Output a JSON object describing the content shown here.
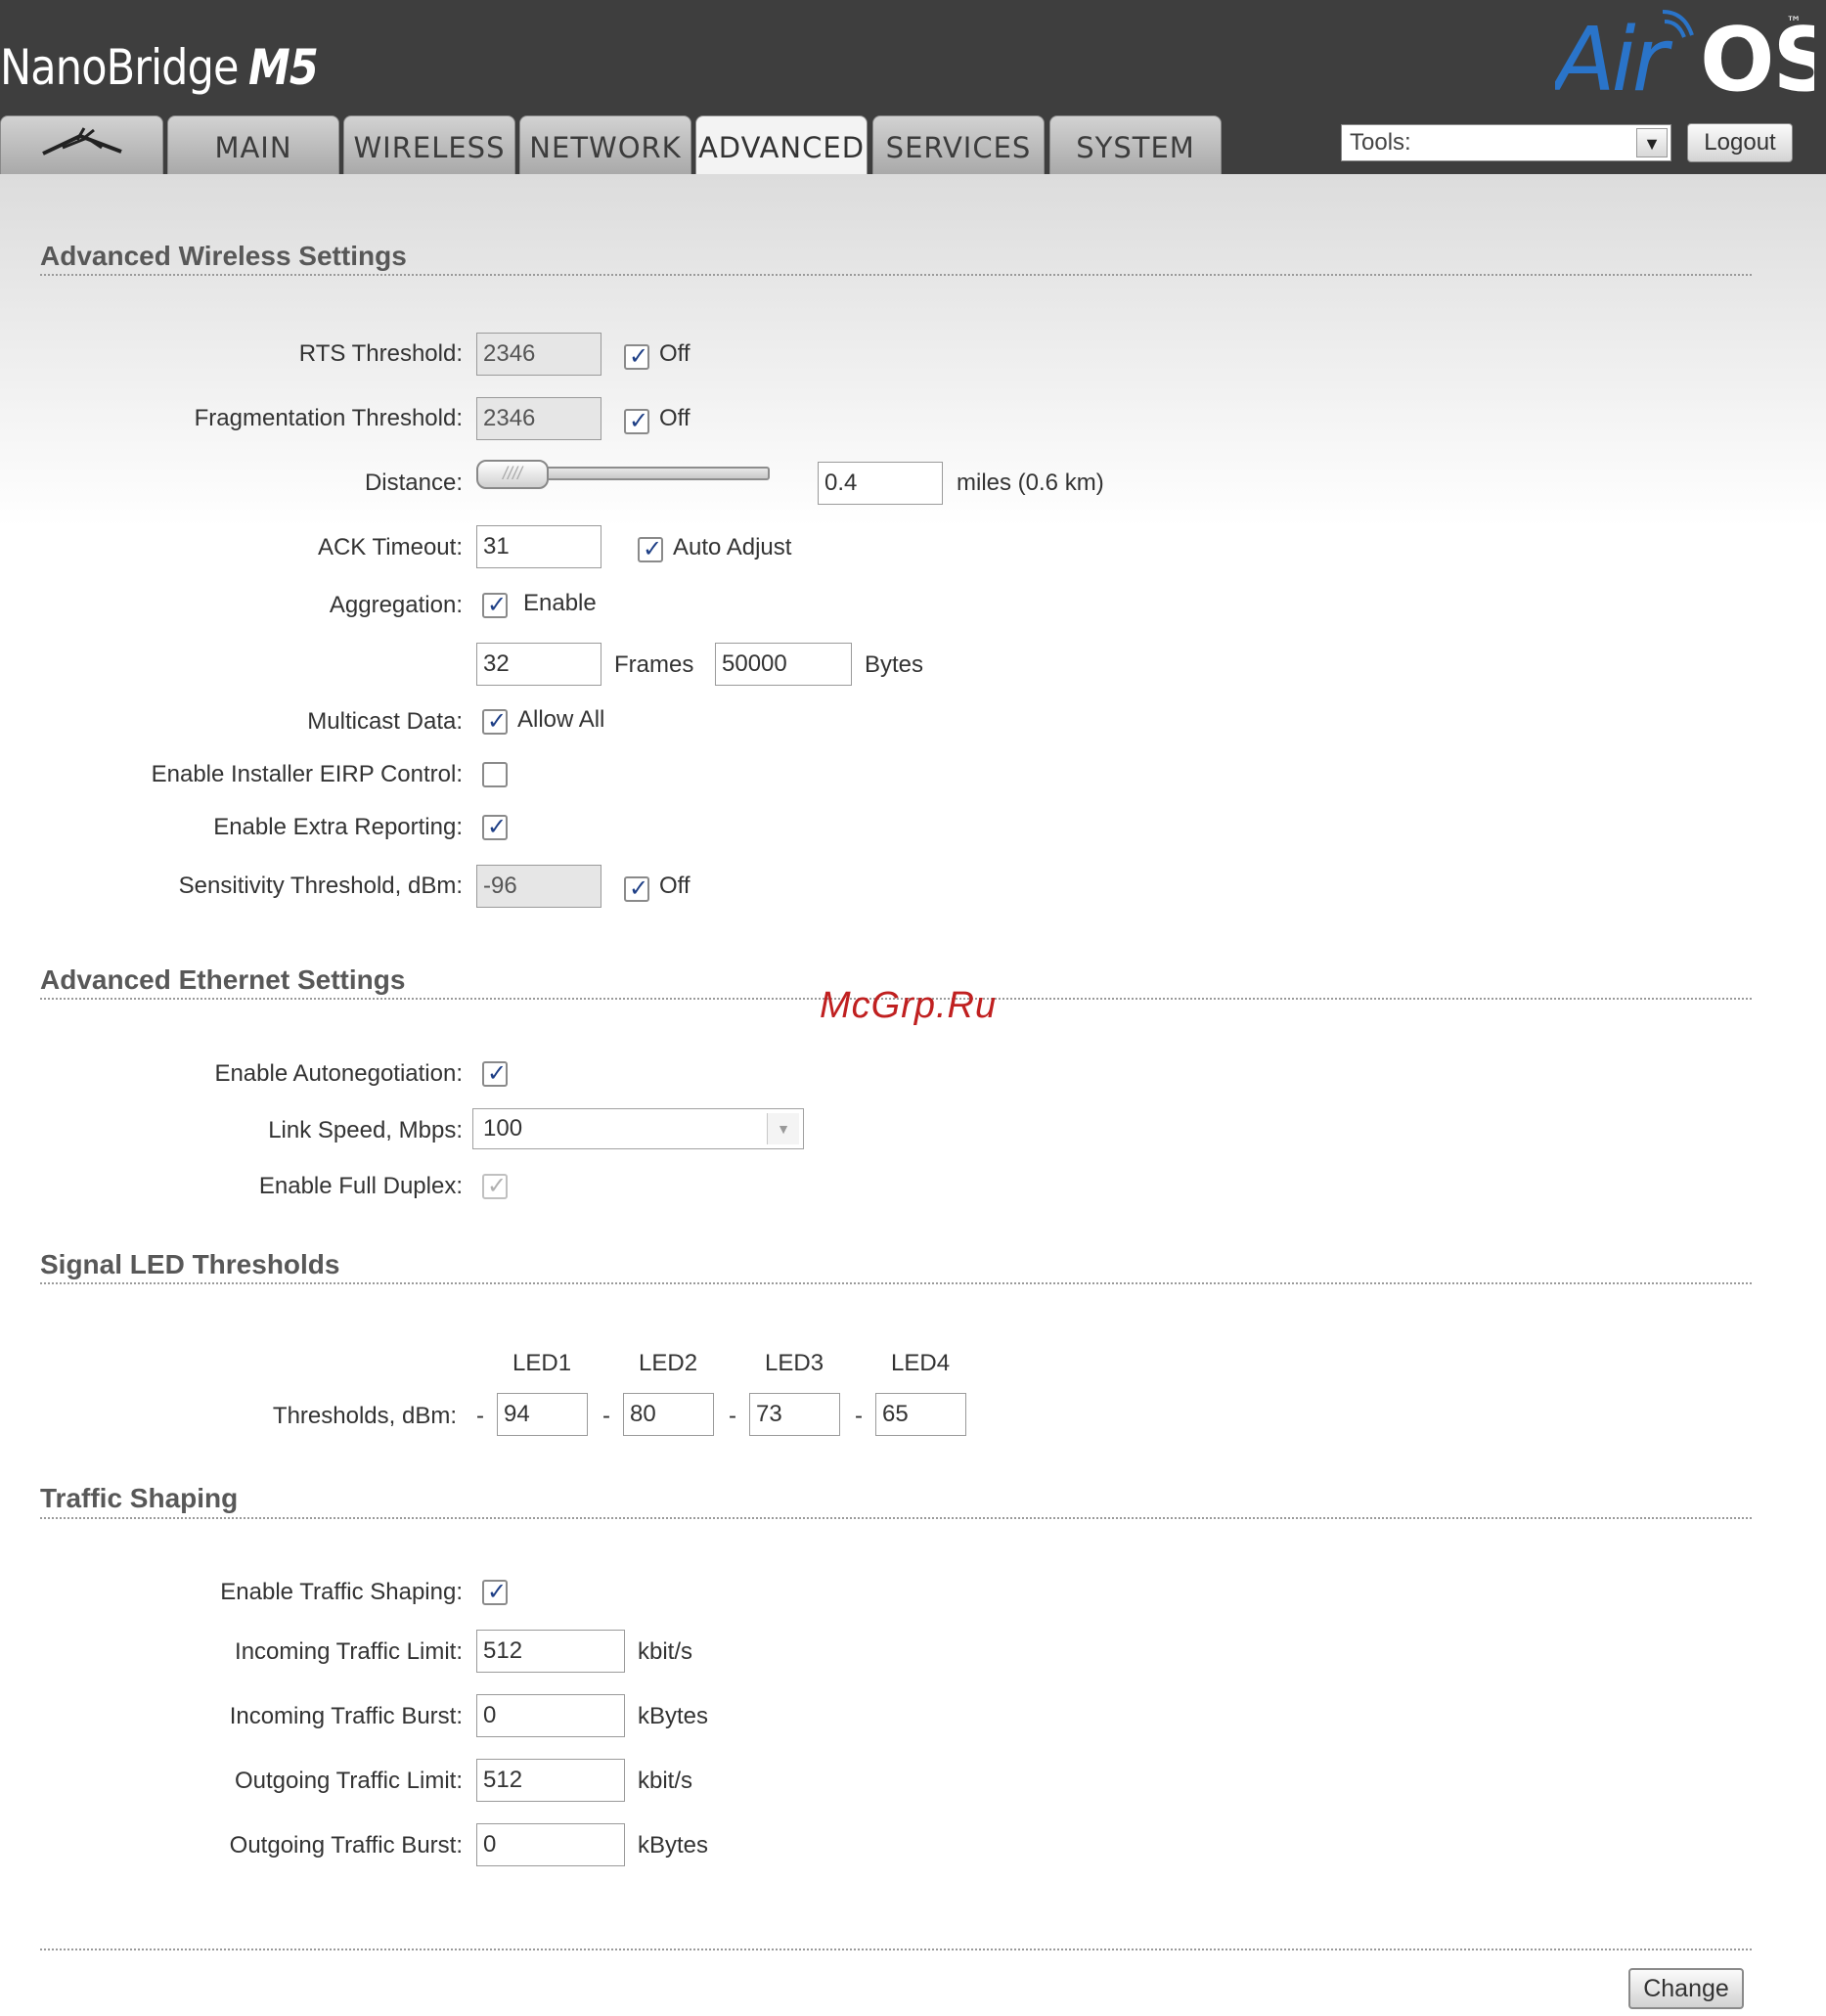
{
  "header": {
    "product_name": "NanoBridge",
    "product_model": "M5",
    "brand_logo": "AirOS",
    "brand_tm": "™",
    "tabs": [
      {
        "label": "MAIN"
      },
      {
        "label": "WIRELESS"
      },
      {
        "label": "NETWORK"
      },
      {
        "label": "ADVANCED"
      },
      {
        "label": "SERVICES"
      },
      {
        "label": "SYSTEM"
      }
    ],
    "active_tab": "ADVANCED",
    "logo_tab_icon": "ubiquiti-logo-icon",
    "tools_label": "Tools:",
    "logout_label": "Logout"
  },
  "wireless": {
    "title": "Advanced Wireless Settings",
    "rts_label": "RTS Threshold:",
    "rts_value": "2346",
    "rts_off_label": "Off",
    "rts_off_checked": true,
    "frag_label": "Fragmentation Threshold:",
    "frag_value": "2346",
    "frag_off_label": "Off",
    "frag_off_checked": true,
    "distance_label": "Distance:",
    "distance_value": "0.4",
    "distance_unit": "miles (0.6 km)",
    "distance_handle_text": "////",
    "ack_label": "ACK Timeout:",
    "ack_value": "31",
    "ack_auto_label": "Auto Adjust",
    "ack_auto_checked": true,
    "aggregation_label": "Aggregation:",
    "aggregation_enable_label": "Enable",
    "aggregation_enabled": true,
    "aggregation_frames": "32",
    "frames_label": "Frames",
    "aggregation_bytes": "50000",
    "bytes_label": "Bytes",
    "multicast_label": "Multicast Data:",
    "multicast_allow_label": "Allow All",
    "multicast_checked": true,
    "eirp_label": "Enable Installer EIRP Control:",
    "eirp_checked": false,
    "extra_reporting_label": "Enable Extra Reporting:",
    "extra_reporting_checked": true,
    "sensitivity_label": "Sensitivity Threshold, dBm:",
    "sensitivity_value": "-96",
    "sensitivity_off_label": "Off",
    "sensitivity_off_checked": true
  },
  "ethernet": {
    "title": "Advanced Ethernet Settings",
    "autoneg_label": "Enable Autonegotiation:",
    "autoneg_checked": true,
    "link_speed_label": "Link Speed, Mbps:",
    "link_speed_value": "100",
    "full_duplex_label": "Enable Full Duplex:",
    "full_duplex_checked": true
  },
  "watermark": "McGrp.Ru",
  "led": {
    "title": "Signal LED Thresholds",
    "headers": [
      "LED1",
      "LED2",
      "LED3",
      "LED4"
    ],
    "thresholds_label": "Thresholds, dBm:",
    "minus": "-",
    "values": [
      "94",
      "80",
      "73",
      "65"
    ]
  },
  "traffic": {
    "title": "Traffic Shaping",
    "enable_label": "Enable Traffic Shaping:",
    "enable_checked": true,
    "in_limit_label": "Incoming Traffic Limit:",
    "in_limit_value": "512",
    "in_limit_unit": "kbit/s",
    "in_burst_label": "Incoming Traffic Burst:",
    "in_burst_value": "0",
    "in_burst_unit": "kBytes",
    "out_limit_label": "Outgoing Traffic Limit:",
    "out_limit_value": "512",
    "out_limit_unit": "kbit/s",
    "out_burst_label": "Outgoing Traffic Burst:",
    "out_burst_value": "0",
    "out_burst_unit": "kBytes"
  },
  "change_label": "Change",
  "colors": {
    "header_bg": "#3e3e3e",
    "check_color": "#1e3f86",
    "logo_blue": "#2a74c9"
  }
}
